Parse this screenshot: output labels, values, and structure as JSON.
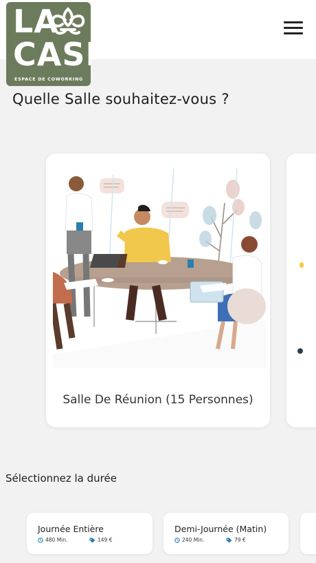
{
  "header": {
    "logo_line1": "LA",
    "logo_line2": "CASE",
    "logo_subtitle": "ESPACE DE COWORKING",
    "menu_icon": "hamburger-menu-icon"
  },
  "page": {
    "title": "Quelle Salle souhaitez-vous ?"
  },
  "rooms": [
    {
      "label": "Salle De Réunion (15 Personnes)",
      "illustration": "meeting-team-illustration"
    }
  ],
  "duration": {
    "title": "Sélectionnez la durée",
    "options": [
      {
        "name": "Journée Entière",
        "minutes": "480 Min.",
        "price": "149 €"
      },
      {
        "name": "Demi-Journée (Matin)",
        "minutes": "240 Min.",
        "price": "79 €"
      }
    ]
  },
  "colors": {
    "brand": "#6d7b5d",
    "accent": "#2a7fae",
    "background": "#f2f2f2"
  }
}
